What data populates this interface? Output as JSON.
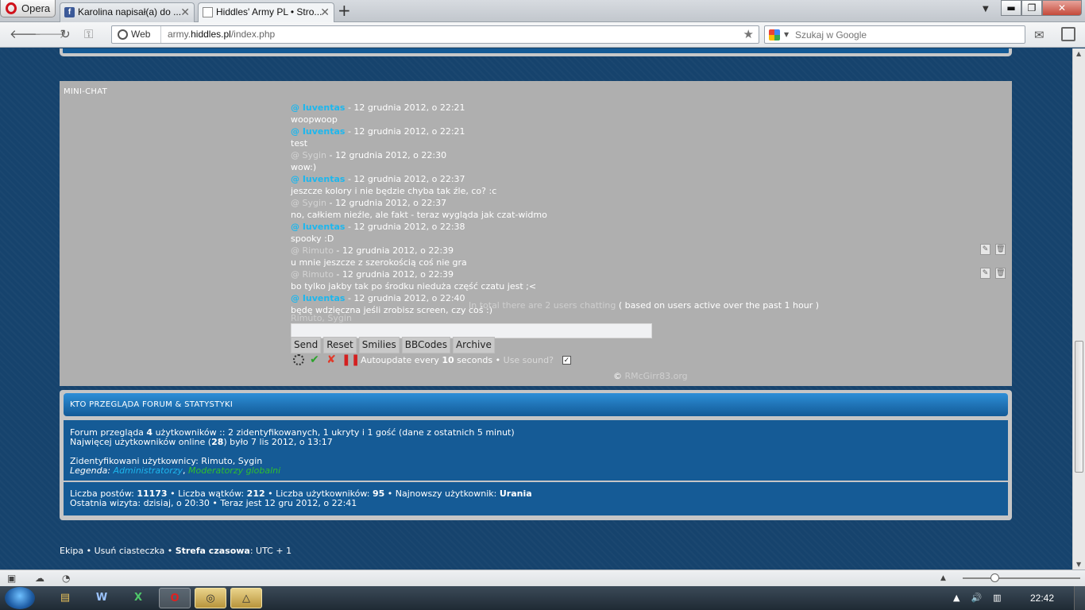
{
  "browser": {
    "opera_label": "Opera",
    "tabs": [
      {
        "title": "Karolina napisał(a) do ...",
        "fav": "f"
      },
      {
        "title": "Hiddles' Army PL • Stro..."
      }
    ],
    "new_tab": "+",
    "window_controls": {
      "minimize": "▬",
      "maximize": "❐",
      "close": "✕"
    },
    "address": {
      "badge": "Web",
      "url_prefix": "army.",
      "url_domain": "hiddles.pl",
      "url_path": "/index.php"
    },
    "search_placeholder": "Szukaj w Google"
  },
  "minichat": {
    "title": "MINI-CHAT",
    "messages": [
      {
        "user": "@ Iuventas",
        "strong": true,
        "date": " - 12 grudnia 2012, o 22:21",
        "text": "woopwoop"
      },
      {
        "user": "@ Iuventas",
        "strong": true,
        "date": " - 12 grudnia 2012, o 22:21",
        "text": "test"
      },
      {
        "user": "@ Sygin",
        "strong": false,
        "date": " - 12 grudnia 2012, o 22:30",
        "text": "wow:)"
      },
      {
        "user": "@ Iuventas",
        "strong": true,
        "date": " - 12 grudnia 2012, o 22:37",
        "text": "jeszcze kolory i nie będzie chyba tak źle, co? :c"
      },
      {
        "user": "@ Sygin",
        "strong": false,
        "date": " - 12 grudnia 2012, o 22:37",
        "text": "no, całkiem nieźle, ale fakt - teraz wygląda jak czat-widmo"
      },
      {
        "user": "@ Iuventas",
        "strong": true,
        "date": " - 12 grudnia 2012, o 22:38",
        "text": "spooky :D"
      },
      {
        "user": "@ Rimuto",
        "strong": false,
        "date": " - 12 grudnia 2012, o 22:39",
        "text": "u mnie jeszcze z szerokością coś nie gra"
      },
      {
        "user": "@ Rimuto",
        "strong": false,
        "date": " - 12 grudnia 2012, o 22:39",
        "text": "bo tylko jakby tak po środku nieduża część czatu jest ;<"
      },
      {
        "user": "@ Iuventas",
        "strong": true,
        "date": " - 12 grudnia 2012, o 22:40",
        "text": "będę wdzięczna jeśli zrobisz screen, czy coś :)"
      }
    ],
    "online_pre": "In total there are 2 users chatting",
    "online_post": " ( based on users active over the past 1 hour )",
    "online_users": "Rimuto, Sygin",
    "buttons": {
      "send": "Send",
      "reset": "Reset",
      "smilies": "Smilies",
      "bbcodes": "BBCodes",
      "archive": "Archive"
    },
    "autoupdate_pre": "Autoupdate every ",
    "autoupdate_num": "10",
    "autoupdate_post": " seconds • ",
    "use_sound": "Use sound?",
    "copyright_sym": "© ",
    "copyright_name": "RMcGirr83.org"
  },
  "stats": {
    "title": "KTO PRZEGLĄDA FORUM & STATYSTYKI",
    "line1_a": "Forum przegląda ",
    "line1_num": "4",
    "line1_b": " użytkowników :: 2 zidentyfikowanych, 1 ukryty i 1 gość (dane z ostatnich 5 minut)",
    "line2_a": "Najwięcej użytkowników online (",
    "line2_num": "28",
    "line2_b": ") było 7 lis 2012, o 13:17",
    "line3": "Zidentyfikowani użytkownicy: Rimuto, Sygin",
    "legend_label": "Legenda: ",
    "legend_admin": "Administratorzy",
    "legend_sep": ", ",
    "legend_mod": "Moderatorzy globalni",
    "posts_label": "Liczba postów: ",
    "posts": "11173",
    "topics_label": " • Liczba wątków: ",
    "topics": "212",
    "users_label": " • Liczba użytkowników: ",
    "users": "95",
    "newest_label": " • Najnowszy użytkownik: ",
    "newest": "Urania",
    "last_visit": "Ostatnia wizyta: dzisiaj, o 20:30 • Teraz jest 12 gru 2012, o 22:41"
  },
  "footer": {
    "team": "Ekipa",
    "sep1": " • ",
    "cookies": "Usuń ciasteczka",
    "sep2": " • ",
    "tz_label": "Strefa czasowa",
    "tz_value": ": UTC + 1"
  },
  "taskbar": {
    "clock": "22:42"
  }
}
